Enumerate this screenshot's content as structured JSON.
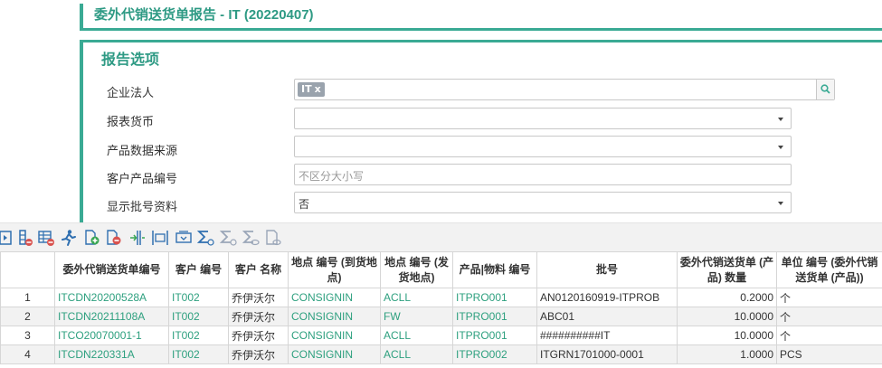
{
  "page": {
    "title": "委外代销送货单报告 - IT (20220407)"
  },
  "options": {
    "header": "报告选项",
    "company": {
      "label": "企业法人",
      "tag": "IT",
      "tag_remove": "x"
    },
    "currency": {
      "label": "报表货币",
      "value": ""
    },
    "product_source": {
      "label": "产品数据来源",
      "value": ""
    },
    "customer_product_no": {
      "label": "客户产品编号",
      "placeholder": "不区分大小写"
    },
    "show_batch": {
      "label": "显示批号资料",
      "value": "否"
    }
  },
  "toolbar": {
    "icons": [
      "toggle-panel-icon",
      "column-filter-icon",
      "grid-settings-icon",
      "run-report-icon",
      "add-document-icon",
      "remove-document-icon",
      "split-column-icon",
      "fit-columns-icon",
      "group-columns-icon",
      "sum-icon",
      "sum-disabled-icon",
      "sum-view-icon",
      "view-settings-icon"
    ]
  },
  "grid": {
    "columns": [
      "",
      "委外代销送货单编号",
      "客户 编号",
      "客户 名称",
      "地点 编号 (到货地点)",
      "地点 编号 (发货地点)",
      "产品|物料 编号",
      "批号",
      "委外代销送货单 (产品) 数量",
      "单位 编号 (委外代销送货单 (产品))"
    ],
    "rows": [
      [
        "1",
        "ITCDN20200528A",
        "IT002",
        "乔伊沃尔",
        "CONSIGNIN",
        "ACLL",
        "ITPRO001",
        "AN0120160919-ITPROB",
        "0.2000",
        "个"
      ],
      [
        "2",
        "ITCDN20211108A",
        "IT002",
        "乔伊沃尔",
        "CONSIGNIN",
        "FW",
        "ITPRO001",
        "ABC01",
        "10.0000",
        "个"
      ],
      [
        "3",
        "ITCO20070001-1",
        "IT002",
        "乔伊沃尔",
        "CONSIGNIN",
        "ACLL",
        "ITPRO001",
        "##########IT",
        "10.0000",
        "个"
      ],
      [
        "4",
        "ITCDN220331A",
        "IT002",
        "乔伊沃尔",
        "CONSIGNIN",
        "ACLL",
        "ITPRO002",
        "ITGRN1701000-0001",
        "1.0000",
        "PCS"
      ]
    ]
  },
  "colors": {
    "accent": "#3aaa94",
    "link": "#2ea07f",
    "add": "#3aa654",
    "remove": "#d9534f",
    "icon": "#2f6fb0"
  }
}
